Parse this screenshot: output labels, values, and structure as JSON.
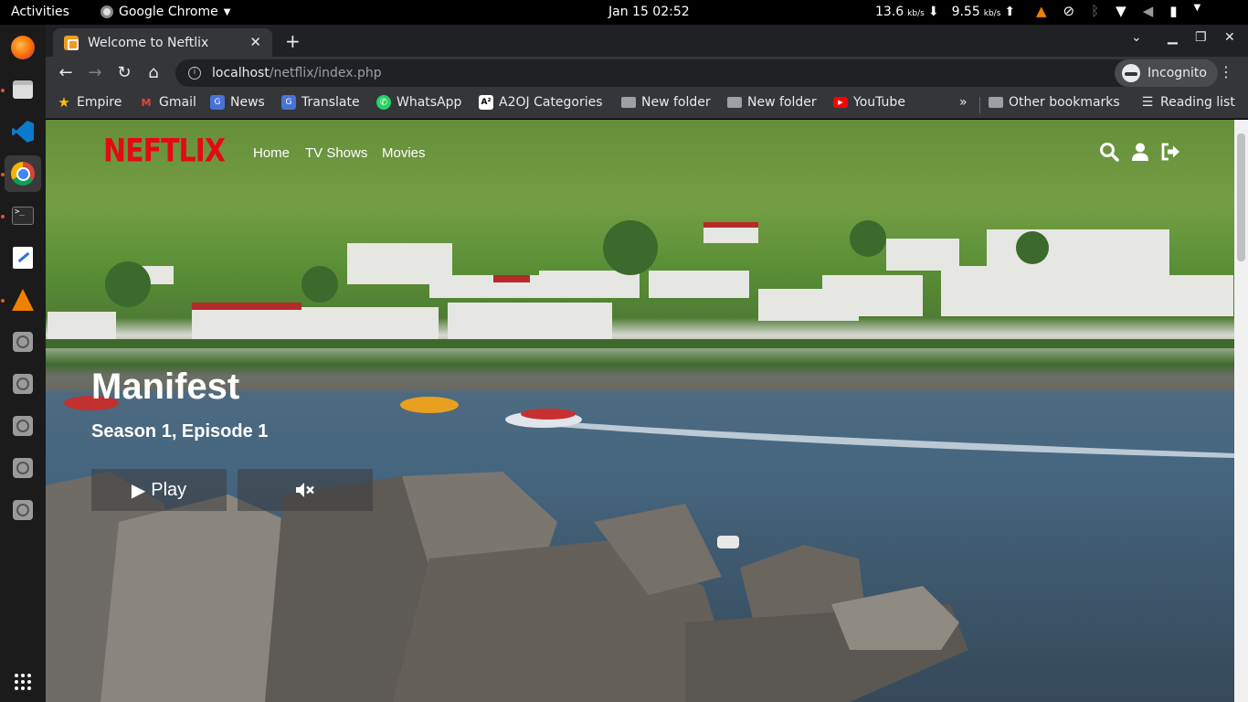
{
  "system_bar": {
    "activities": "Activities",
    "app_name": "Google Chrome",
    "clock": "Jan 15  02:52",
    "net_down": "13.6",
    "net_down_unit": "kb/s",
    "net_up": "9.55",
    "net_up_unit": "kb/s"
  },
  "dock": {
    "items": [
      "firefox-icon",
      "files-icon",
      "vscode-icon",
      "chrome-icon",
      "terminal-icon",
      "text-editor-icon",
      "vlc-icon",
      "disk-icon",
      "disk-icon",
      "disk-icon",
      "disk-icon",
      "disk-icon",
      "app-grid-icon"
    ]
  },
  "browser": {
    "tab_title": "Welcome to Neftlix",
    "url_host": "localhost",
    "url_path": "/netflix/index.php",
    "profile_label": "Incognito",
    "bookmarks": [
      {
        "label": "Empire",
        "icon": "star-icon"
      },
      {
        "label": "Gmail",
        "icon": "gmail-icon"
      },
      {
        "label": "News",
        "icon": "news-icon"
      },
      {
        "label": "Translate",
        "icon": "translate-icon"
      },
      {
        "label": "WhatsApp",
        "icon": "whatsapp-icon"
      },
      {
        "label": "A2OJ Categories",
        "icon": "a2oj-icon"
      },
      {
        "label": "New folder",
        "icon": "folder-icon"
      },
      {
        "label": "New folder",
        "icon": "folder-icon"
      },
      {
        "label": "YouTube",
        "icon": "youtube-icon"
      }
    ],
    "overflow": "»",
    "other_bookmarks": "Other bookmarks",
    "reading_list": "Reading list"
  },
  "site": {
    "logo": "NEFTLIX",
    "nav": [
      "Home",
      "TV Shows",
      "Movies"
    ],
    "hero": {
      "title": "Manifest",
      "subtitle": "Season 1, Episode 1",
      "play_label": "Play"
    },
    "brand_color": "#e50914"
  }
}
